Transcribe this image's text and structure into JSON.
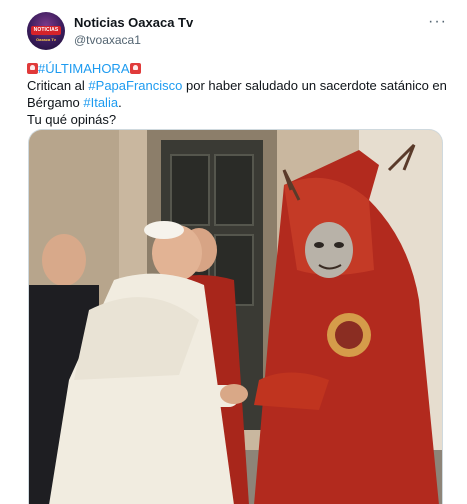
{
  "author": {
    "name": "Noticias Oaxaca Tv",
    "handle": "@tvoaxaca1",
    "avatar_badge": "NOTICIAS",
    "avatar_sub": "Oaxaca Tv"
  },
  "more_icon": "more-horizontal-icon",
  "tweet": {
    "line1_hashtag": "#ÚLTIMAHORA",
    "line2_pre": "Critican al ",
    "line2_hashtag": "#PapaFrancisco",
    "line2_post": " por haber saludado un sacerdote satánico en",
    "line3_pre": "Bérgamo ",
    "line3_hashtag": "#Italia",
    "line3_post": ".",
    "line4": "Tu qué opinás?"
  },
  "media": {
    "description_icon": "photo-image",
    "colors": {
      "wall": "#c9b79f",
      "door": "#3a3a34",
      "red_robe": "#b22a1e",
      "white_cassock": "#f1ece0"
    }
  },
  "colors": {
    "accent": "#1d9bf0",
    "text": "#0f1419",
    "muted": "#536471",
    "siren": "#e03a3a"
  }
}
